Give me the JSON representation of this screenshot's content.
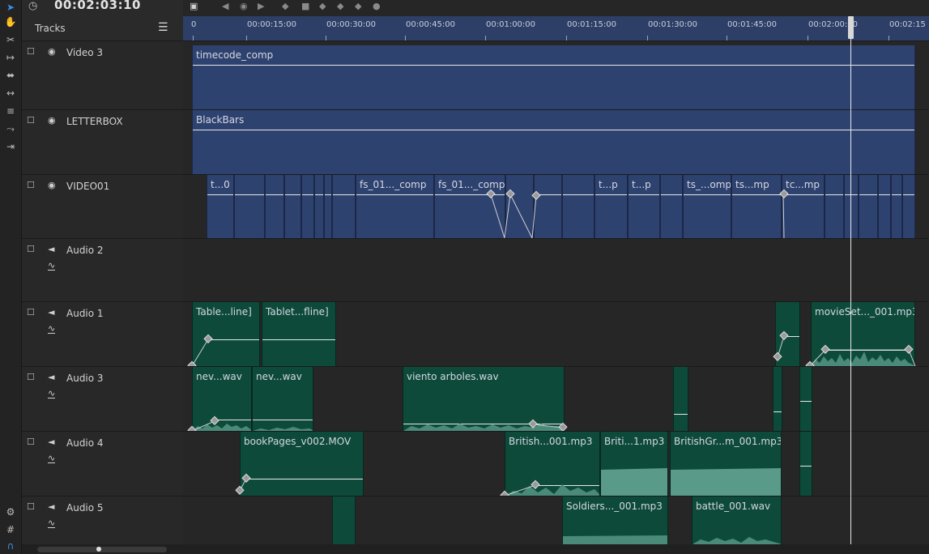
{
  "header": {
    "timecode": "00:02:03:10",
    "tracks_label": "Tracks"
  },
  "ruler": {
    "labels": [
      "0",
      "00:00:15:00",
      "00:00:30:00",
      "00:00:45:00",
      "00:01:00:00",
      "00:01:15:00",
      "00:01:30:00",
      "00:01:45:00",
      "00:02:00:00",
      "00:02:15"
    ]
  },
  "tracks": [
    {
      "name": "Video 3",
      "type": "video"
    },
    {
      "name": "LETTERBOX",
      "type": "video"
    },
    {
      "name": "VIDEO01",
      "type": "video"
    },
    {
      "name": "Audio 2",
      "type": "audio"
    },
    {
      "name": "Audio 1",
      "type": "audio"
    },
    {
      "name": "Audio 3",
      "type": "audio"
    },
    {
      "name": "Audio 4",
      "type": "audio"
    },
    {
      "name": "Audio 5",
      "type": "audio"
    }
  ],
  "clips": {
    "video3": [
      "timecode_comp"
    ],
    "letterbox": [
      "BlackBars"
    ],
    "video01": [
      "t...0",
      "fs_01..._comp",
      "fs_01..._comp",
      "t...p",
      "t...p",
      "ts_...omp",
      "ts...mp",
      "tc...mp"
    ],
    "audio1": [
      "Table...line]",
      "Tablet...fline]",
      "movieSet..._001.mp3"
    ],
    "audio3": [
      "nev...wav",
      "nev...wav",
      "viento arboles.wav"
    ],
    "audio4": [
      "bookPages_v002.MOV",
      "British...001.mp3",
      "Briti...1.mp3",
      "BritishGr...m_001.mp3"
    ],
    "audio5": [
      "Soldiers..._001.mp3",
      "battle_001.wav"
    ]
  },
  "colors": {
    "video_clip": "#2e4270",
    "audio_clip": "#0d4a3a",
    "ruler": "#2d3f66",
    "accent": "#3a8ee6"
  },
  "icons": [
    "arrow-select-icon",
    "hand-icon",
    "razor-icon",
    "ripple-icon",
    "slip-icon",
    "slide-icon",
    "rate-stretch-icon",
    "curve-icon",
    "export-icon",
    "settings-icon",
    "snap-icon",
    "magnet-icon"
  ]
}
